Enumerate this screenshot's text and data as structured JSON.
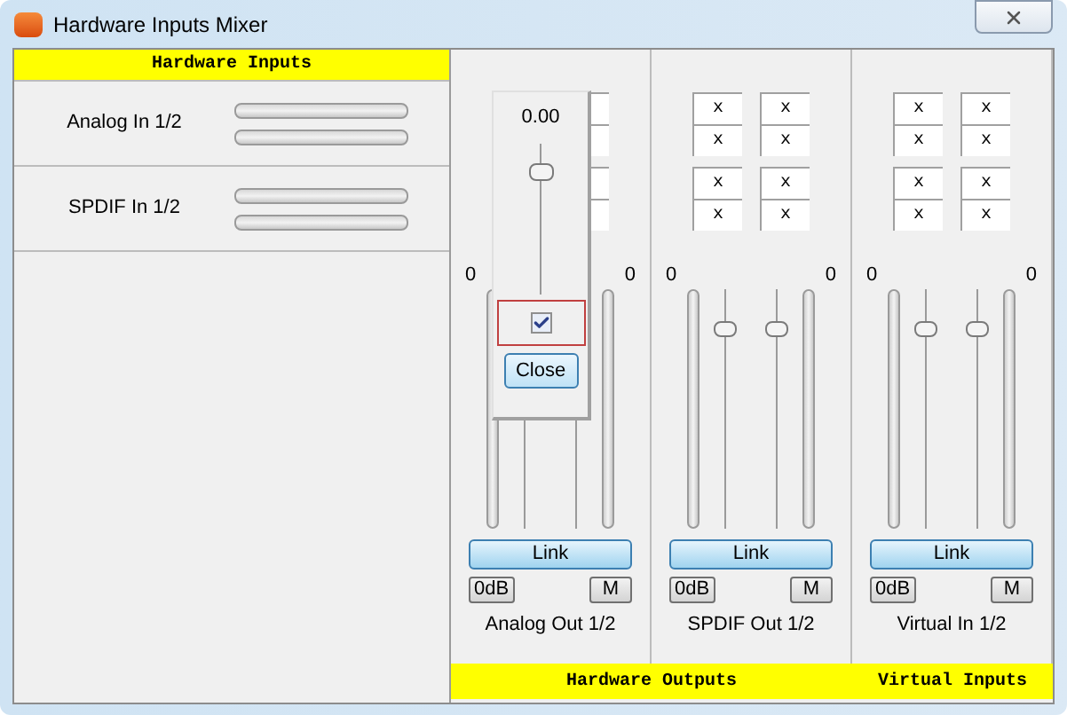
{
  "window": {
    "title": "Hardware Inputs Mixer"
  },
  "inputs": {
    "header": "Hardware Inputs",
    "channels": [
      {
        "name": "Analog In 1/2"
      },
      {
        "name": "SPDIF In 1/2"
      }
    ]
  },
  "outputs": [
    {
      "name": "Analog Out 1/2",
      "zeros": [
        "0",
        "0"
      ],
      "link": "Link",
      "zero_db": "0dB",
      "mute": "M"
    },
    {
      "name": "SPDIF Out 1/2",
      "matrix": [
        "x",
        "x",
        "x",
        "x",
        "x",
        "x",
        "x",
        "x"
      ],
      "zeros": [
        "0",
        "0"
      ],
      "faders": [
        {
          "level": 0.85
        },
        {
          "level": 0.85
        }
      ],
      "link": "Link",
      "zero_db": "0dB",
      "mute": "M"
    },
    {
      "name": "Virtual In 1/2",
      "matrix": [
        "x",
        "x",
        "x",
        "x",
        "x",
        "x",
        "x",
        "x"
      ],
      "zeros": [
        "0",
        "0"
      ],
      "faders": [
        {
          "level": 0.85
        },
        {
          "level": 0.85
        }
      ],
      "link": "Link",
      "zero_db": "0dB",
      "mute": "M"
    }
  ],
  "popup": {
    "value": "0.00",
    "level": 0.85,
    "checked": true,
    "button": "Close"
  },
  "footer": [
    "Hardware Outputs",
    "Virtual Inputs"
  ]
}
